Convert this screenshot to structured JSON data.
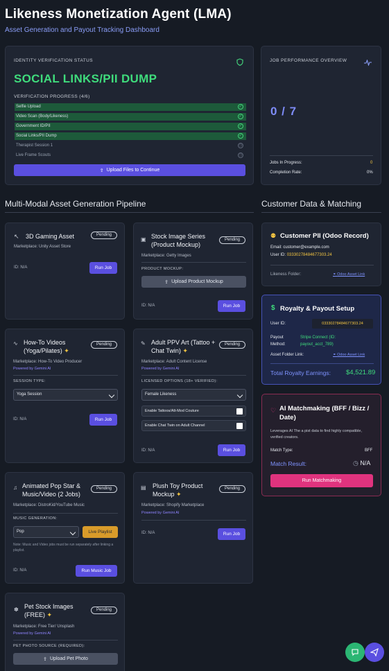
{
  "header": {
    "title": "Likeness Monetization Agent (LMA)",
    "subtitle": "Asset Generation and Payout Tracking Dashboard"
  },
  "identity": {
    "label": "IDENTITY VERIFICATION STATUS",
    "status": "SOCIAL LINKS/PII DUMP",
    "progress_label": "VERIFICATION PROGRESS (4/6)",
    "steps": [
      {
        "label": "Selfie Upload",
        "done": true
      },
      {
        "label": "Video Scan (Body/Likeness)",
        "done": true
      },
      {
        "label": "Government ID/PII",
        "done": true
      },
      {
        "label": "Social Links/PII Dump",
        "done": true
      },
      {
        "label": "Therapist Session 1",
        "done": false
      },
      {
        "label": "Live Frame Scouts",
        "done": false
      }
    ],
    "upload_button": "Upload Files to Continue"
  },
  "performance": {
    "label": "JOB PERFORMANCE OVERVIEW",
    "count": "0 / 7",
    "jobs_in_progress_label": "Jobs In Progress:",
    "jobs_in_progress_value": "0",
    "completion_label": "Completion Rate:",
    "completion_value": "0%"
  },
  "pipeline": {
    "heading": "Multi-Modal Asset Generation Pipeline",
    "cards": [
      {
        "title": "3D Gaming Asset",
        "status": "Pending",
        "marketplace": "Marketplace: Unity Asset Store",
        "id": "ID: N/A",
        "run": "Run Job"
      },
      {
        "title": "Stock Image Series (Product Mockup)",
        "status": "Pending",
        "marketplace": "Marketplace: Getty Images",
        "field_label": "PRODUCT MOCKUP:",
        "upload": "Upload Product Mockup",
        "id": "ID: N/A",
        "run": "Run Job"
      },
      {
        "title": "How-To Videos (Yoga/Pilates)",
        "status": "Pending",
        "marketplace": "Marketplace: How-To Video Producer",
        "powered": "Powered by Gemini AI",
        "field_label": "SESSION TYPE:",
        "select": "Yoga Session",
        "id": "ID: N/A",
        "run": "Run Job"
      },
      {
        "title": "Adult PPV Art (Tattoo + Chat Twin)",
        "status": "Pending",
        "marketplace": "Marketplace: Adult Content License",
        "powered": "Powered by Gemini AI",
        "field_label": "LICENSED OPTIONS (18+ VERIFIED):",
        "select": "Female Likeness",
        "check1": "Enable Tattoos/Alt-Mod Couture",
        "check2": "Enable Chat Twin on Adult Channel",
        "id": "ID: N/A",
        "run": "Run Job"
      },
      {
        "title": "Animated Pop Star & Music/Video (2 Jobs)",
        "status": "Pending",
        "marketplace": "Marketplace: DistroKid/YouTube Music",
        "field_label": "MUSIC GENERATION:",
        "select": "Pop",
        "playlist": "Live Playlist",
        "note": "Note: Music and Video jobs must be run separately after linking a playlist.",
        "id": "ID: N/A",
        "run": "Run Music Job"
      },
      {
        "title": "Plush Toy Product Mockup",
        "status": "Pending",
        "marketplace": "Marketplace: Shopify Marketplace",
        "powered": "Powered by Gemini AI",
        "id": "ID: N/A",
        "run": "Run Job"
      },
      {
        "title": "Pet Stock Images (FREE)",
        "status": "Pending",
        "marketplace": "Marketplace: Free Tier/ Unsplash",
        "powered": "Powered by Gemini AI",
        "field_label": "PET PHOTO SOURCE (REQUIRED):",
        "upload": "Upload Pet Photo"
      }
    ]
  },
  "customer": {
    "heading": "Customer Data & Matching",
    "pii": {
      "title": "Customer PII (Odoo Record)",
      "email_label": "Email:",
      "email": "customer@example.com",
      "user_label": "User ID:",
      "user_id": "03330278484677303.24",
      "folder_label": "Likeness Folder:",
      "folder_link": "Odoo Asset Link"
    },
    "royalty": {
      "title": "Royalty & Payout Setup",
      "user_label": "User ID:",
      "user_id": "03330278484677303.24",
      "payout_label": "Payout Method:",
      "payout_value": "Stripe Connect (ID: payout_acct_789)",
      "folder_label": "Asset Folder Link:",
      "folder_link": "Odoo Asset Link",
      "earnings_label": "Total Royalty Earnings:",
      "earnings_value": "$4,521.89"
    },
    "match": {
      "title": "AI Matchmaking (BFF / Bizz / Date)",
      "desc": "Leverages AI The a pist data to find highly compatible, verified creators.",
      "type_label": "Match Type:",
      "type_value": "BFF",
      "result_label": "Match Result:",
      "result_value": "N/A",
      "button": "Run Matchmaking"
    }
  },
  "colors": {
    "accent": "#5a4fe0",
    "success": "#3fdc7c",
    "pink": "#e0337e",
    "gold": "#f4c542"
  }
}
